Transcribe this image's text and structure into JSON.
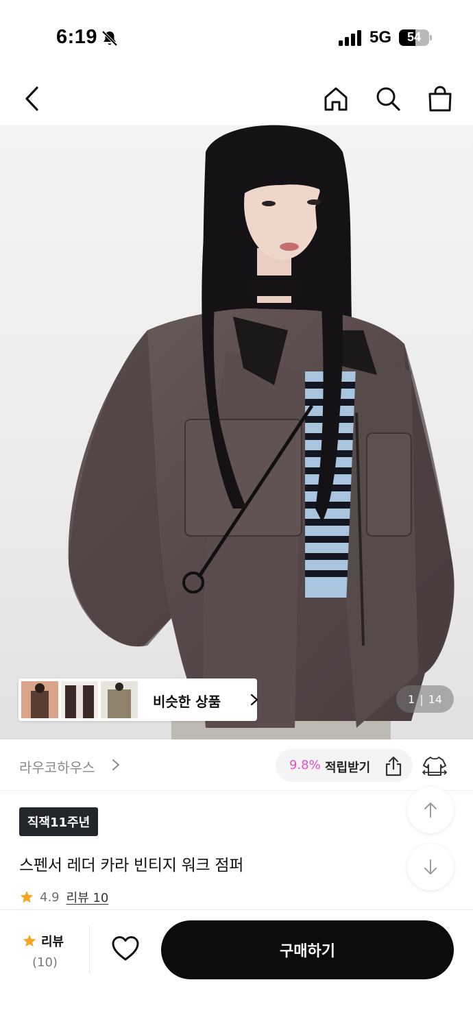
{
  "status_bar": {
    "time": "6:19",
    "network": "5G",
    "battery": "54",
    "battery_level": 0.54
  },
  "nav": {
    "back_icon": "chevron-left-icon",
    "home_icon": "home-icon",
    "search_icon": "search-icon",
    "cart_icon": "shopping-bag-icon"
  },
  "gallery": {
    "similar_label": "비슷한 상품",
    "current": "1",
    "separator": "|",
    "total": "14"
  },
  "brand": {
    "name": "라우코하우스",
    "points_rate": "9.8%",
    "points_label": "적립받기"
  },
  "product": {
    "badge": "직잭11주년",
    "title": "스펜서 레더 카라 빈티지 워크 점퍼",
    "rating": "4.9",
    "review_link": "리뷰 10"
  },
  "bottom": {
    "review_label": "리뷰",
    "review_count": "(10)",
    "buy_label": "구매하기"
  },
  "colors": {
    "accent_points": "#e54bd0",
    "star": "#f5a623",
    "buy_button": "#0c0c0c",
    "badge": "#23262b"
  }
}
